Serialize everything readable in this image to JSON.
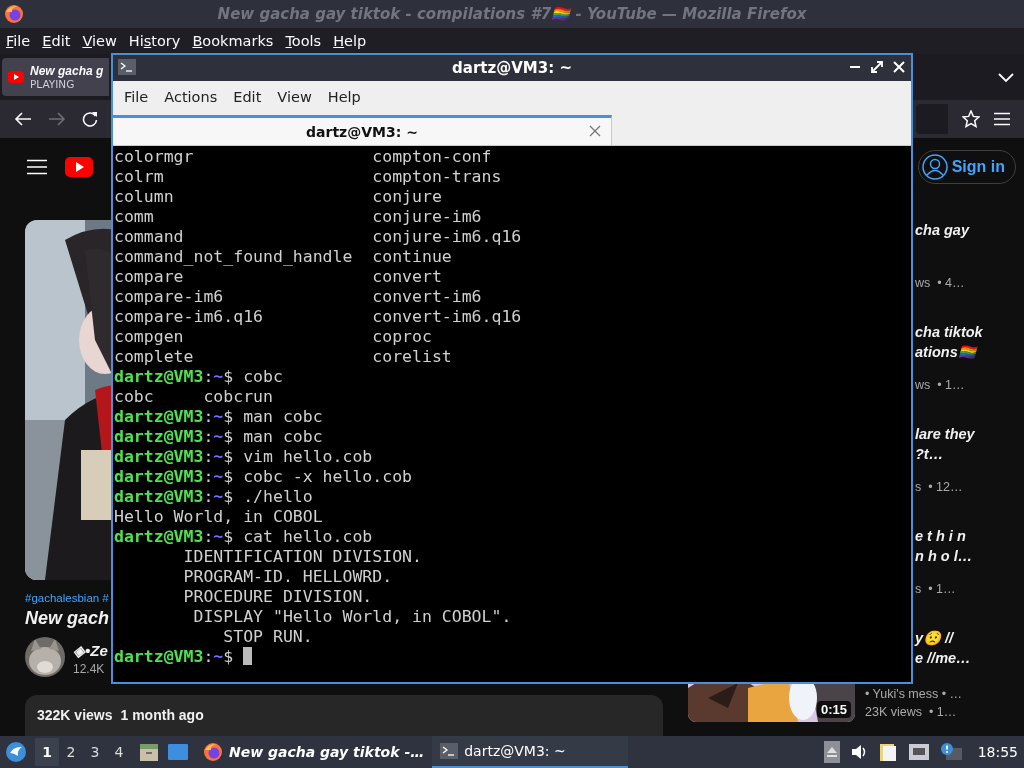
{
  "firefox": {
    "title": "New gacha gay tiktok - compilations #7🏳️‍🌈 - YouTube — Mozilla Firefox",
    "menu": [
      {
        "key": "F",
        "post": "ile"
      },
      {
        "key": "E",
        "post": "dit"
      },
      {
        "key": "V",
        "post": "iew"
      },
      {
        "pre": "Hi",
        "key": "s",
        "post": "tory"
      },
      {
        "key": "B",
        "post": "ookmarks"
      },
      {
        "key": "T",
        "post": "ools"
      },
      {
        "key": "H",
        "post": "elp"
      }
    ],
    "tab": {
      "title": "New gacha g",
      "status": "PLAYING"
    },
    "nav": {
      "forward": {
        "disabled": true
      }
    }
  },
  "youtube": {
    "sign_in": "Sign in",
    "hashtags": "#gachalesbian #",
    "title": "New gach",
    "channel": "◈•Ze",
    "subscribers": "12.4K",
    "views": "322K views",
    "age": "1 month ago",
    "related": [
      {
        "title_lines": [
          "cha gay"
        ],
        "meta": "ws  • 4…"
      },
      {
        "title_lines": [
          "cha tiktok",
          "ations🏳️‍🌈"
        ],
        "meta": "ws  • 1…"
      },
      {
        "title_lines": [
          "lare they",
          "?t…"
        ],
        "meta": "s  • 12…"
      },
      {
        "title_lines": [
          "e t h i n",
          "n h o l…"
        ],
        "meta": "s  • 1…"
      },
      {
        "title_lines": [
          "y😟 //",
          "e //me…"
        ],
        "channel": "• Yuki's mess • …",
        "meta": "23K views  • 1…",
        "thumbnail": {
          "duration": "0:15"
        }
      }
    ]
  },
  "terminal": {
    "title": "dartz@VM3: ~",
    "menu": [
      "File",
      "Actions",
      "Edit",
      "View",
      "Help"
    ],
    "tab": "dartz@VM3: ~",
    "lines": [
      {
        "kind": "output",
        "text": "colormgr                  compton-conf"
      },
      {
        "kind": "output",
        "text": "colrm                     compton-trans"
      },
      {
        "kind": "output",
        "text": "column                    conjure"
      },
      {
        "kind": "output",
        "text": "comm                      conjure-im6"
      },
      {
        "kind": "output",
        "text": "command                   conjure-im6.q16"
      },
      {
        "kind": "output",
        "text": "command_not_found_handle  continue"
      },
      {
        "kind": "output",
        "text": "compare                   convert"
      },
      {
        "kind": "output",
        "text": "compare-im6               convert-im6"
      },
      {
        "kind": "output",
        "text": "compare-im6.q16           convert-im6.q16"
      },
      {
        "kind": "output",
        "text": "compgen                   coproc"
      },
      {
        "kind": "output",
        "text": "complete                  corelist"
      },
      {
        "kind": "prompt",
        "user": "dartz@VM3",
        "sep": ":",
        "path": "~",
        "sign": "$",
        "command": "cobc"
      },
      {
        "kind": "output",
        "text": "cobc     cobcrun"
      },
      {
        "kind": "prompt",
        "user": "dartz@VM3",
        "sep": ":",
        "path": "~",
        "sign": "$",
        "command": "man cobc"
      },
      {
        "kind": "prompt",
        "user": "dartz@VM3",
        "sep": ":",
        "path": "~",
        "sign": "$",
        "command": "man cobc"
      },
      {
        "kind": "prompt",
        "user": "dartz@VM3",
        "sep": ":",
        "path": "~",
        "sign": "$",
        "command": "vim hello.cob"
      },
      {
        "kind": "prompt",
        "user": "dartz@VM3",
        "sep": ":",
        "path": "~",
        "sign": "$",
        "command": "cobc -x hello.cob"
      },
      {
        "kind": "prompt",
        "user": "dartz@VM3",
        "sep": ":",
        "path": "~",
        "sign": "$",
        "command": "./hello"
      },
      {
        "kind": "output",
        "text": "Hello World, in COBOL"
      },
      {
        "kind": "prompt",
        "user": "dartz@VM3",
        "sep": ":",
        "path": "~",
        "sign": "$",
        "command": "cat hello.cob"
      },
      {
        "kind": "output",
        "text": "       IDENTIFICATION DIVISION."
      },
      {
        "kind": "output",
        "text": "       PROGRAM-ID. HELLOWRD."
      },
      {
        "kind": "output",
        "text": "       PROCEDURE DIVISION."
      },
      {
        "kind": "output",
        "text": "        DISPLAY \"Hello World, in COBOL\"."
      },
      {
        "kind": "output",
        "text": "           STOP RUN."
      },
      {
        "kind": "prompt",
        "user": "dartz@VM3",
        "sep": ":",
        "path": "~",
        "sign": "$",
        "cursor": true
      }
    ]
  },
  "taskbar": {
    "workspaces": [
      {
        "label": "1",
        "selected": true
      },
      {
        "label": "2",
        "selected": false
      },
      {
        "label": "3",
        "selected": false
      },
      {
        "label": "4",
        "selected": false
      }
    ],
    "tasks": [
      {
        "kind": "browser",
        "label": "New gacha gay tiktok -…",
        "selected": false
      },
      {
        "kind": "terminal",
        "label": "dartz@VM3: ~",
        "selected": true
      }
    ],
    "clock": "18:55"
  }
}
